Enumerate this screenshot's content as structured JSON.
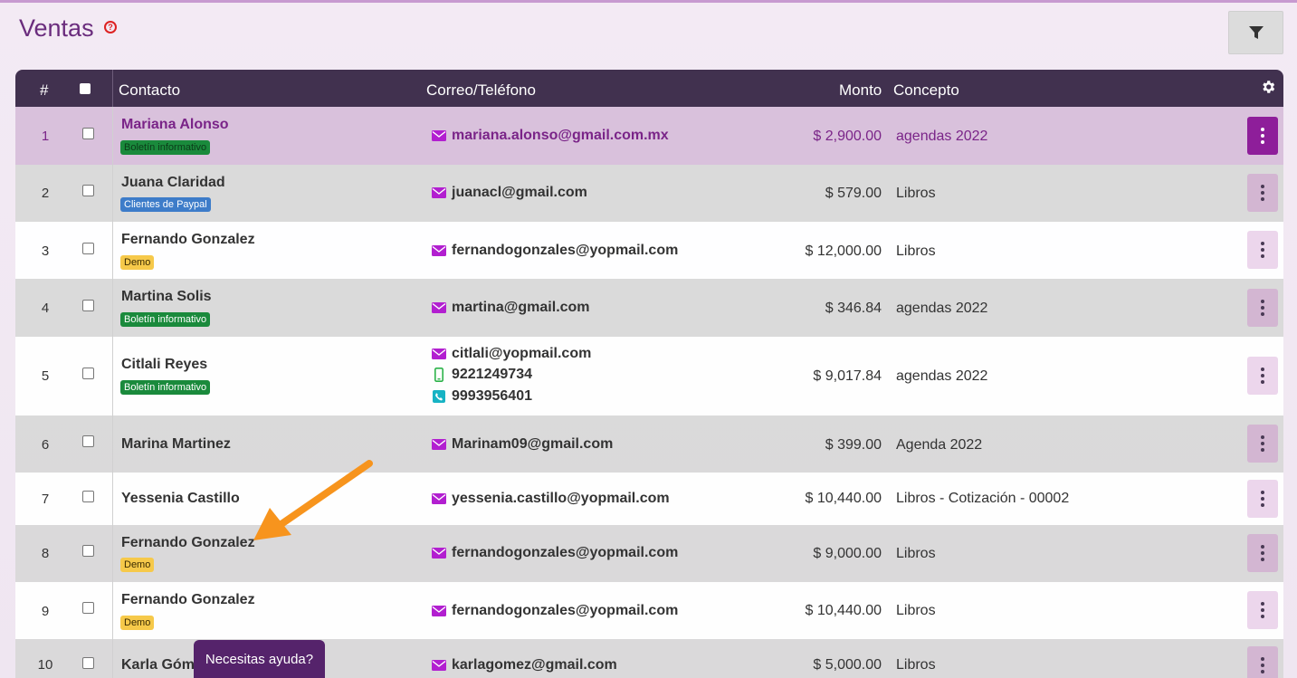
{
  "page": {
    "title": "Ventas",
    "help_icon": "question-circle-icon",
    "filter_icon": "filter-icon",
    "help_button_label": "Necesitas ayuda?"
  },
  "colors": {
    "header_bg": "#41314f",
    "brand_purple": "#7a2488",
    "email_icon": "#b21fd0",
    "mobile_icon": "#2db34a",
    "phone_icon": "#17b3c4",
    "arrow": "#f7941d"
  },
  "table": {
    "headers": {
      "num": "#",
      "contacto": "Contacto",
      "correo": "Correo/Teléfono",
      "monto": "Monto",
      "concepto": "Concepto"
    },
    "rows": [
      {
        "num": "1",
        "name": "Mariana Alonso",
        "tag": "Boletín informativo",
        "email": "mariana.alonso@gmail.com.mx",
        "monto": "$ 2,900.00",
        "concepto": "agendas 2022"
      },
      {
        "num": "2",
        "name": "Juana Claridad",
        "tag": "Clientes de Paypal",
        "email": "juanacl@gmail.com",
        "monto": "$ 579.00",
        "concepto": "Libros"
      },
      {
        "num": "3",
        "name": "Fernando Gonzalez",
        "tag": "Demo",
        "email": "fernandogonzales@yopmail.com",
        "monto": "$ 12,000.00",
        "concepto": "Libros"
      },
      {
        "num": "4",
        "name": "Martina Solis",
        "tag": "Boletín informativo",
        "email": "martina@gmail.com",
        "monto": "$ 346.84",
        "concepto": "agendas 2022"
      },
      {
        "num": "5",
        "name": "Citlali Reyes",
        "tag": "Boletín informativo",
        "email": "citlali@yopmail.com",
        "mobile": "9221249734",
        "phone": "9993956401",
        "monto": "$ 9,017.84",
        "concepto": "agendas 2022"
      },
      {
        "num": "6",
        "name": "Marina Martinez",
        "email": "Marinam09@gmail.com",
        "monto": "$ 399.00",
        "concepto": "Agenda 2022"
      },
      {
        "num": "7",
        "name": "Yessenia Castillo",
        "email": "yessenia.castillo@yopmail.com",
        "monto": "$ 10,440.00",
        "concepto": "Libros - Cotización - 00002"
      },
      {
        "num": "8",
        "name": "Fernando Gonzalez",
        "tag": "Demo",
        "email": "fernandogonzales@yopmail.com",
        "monto": "$ 9,000.00",
        "concepto": "Libros"
      },
      {
        "num": "9",
        "name": "Fernando Gonzalez",
        "tag": "Demo",
        "email": "fernandogonzales@yopmail.com",
        "monto": "$ 10,440.00",
        "concepto": "Libros"
      },
      {
        "num": "10",
        "name": "Karla Góm",
        "email": "karlagomez@gmail.com",
        "monto": "$ 5,000.00",
        "concepto": "Libros"
      }
    ]
  }
}
